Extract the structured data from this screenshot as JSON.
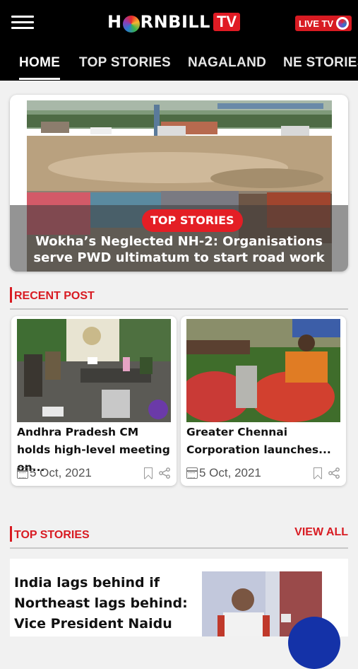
{
  "header": {
    "menu_icon": "hamburger-icon",
    "logo_text_left": "H",
    "logo_text_right": "RNBILL",
    "logo_tv": "TV",
    "live_label": "LIVE TV",
    "live_icon": "hornbill-eye-icon",
    "brand_color": "#d81b22"
  },
  "tabs": [
    {
      "label": "HOME",
      "active": true
    },
    {
      "label": "TOP STORIES",
      "active": false
    },
    {
      "label": "NAGALAND",
      "active": false
    },
    {
      "label": "NE STORIES",
      "active": false
    }
  ],
  "hero": {
    "badge": "TOP STORIES",
    "title": "Wokha’s Neglected NH-2: Organisations serve PWD ultimatum to start road work"
  },
  "recent_post": {
    "heading": "RECENT POST",
    "cards": [
      {
        "title": "Andhra Pradesh CM holds high-level meeting on...",
        "date": "5 Oct, 2021"
      },
      {
        "title": "Greater Chennai Corporation launches...",
        "date": "5 Oct, 2021"
      }
    ]
  },
  "top_stories": {
    "heading": "TOP STORIES",
    "view_all": "VIEW ALL",
    "story_title": "India lags behind if Northeast lags behind: Vice President Naidu"
  }
}
